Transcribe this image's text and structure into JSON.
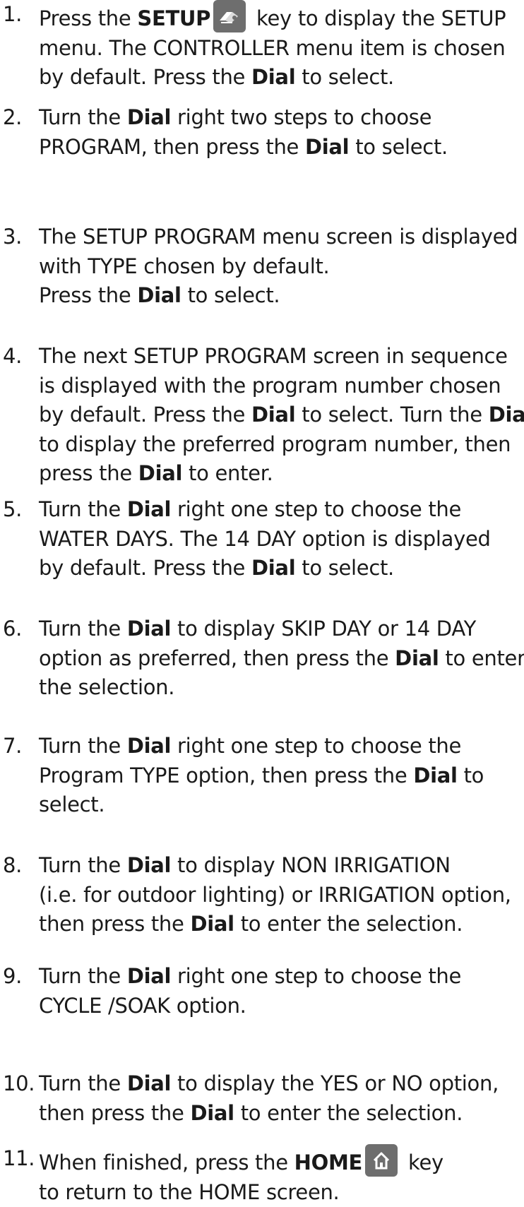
{
  "steps": [
    {
      "number": "1.",
      "lines": [
        [
          {
            "t": "Press the "
          },
          {
            "t": "SETUP",
            "b": true
          },
          {
            "icon": "setup-key-icon"
          },
          {
            "t": " key to display the SETUP"
          }
        ],
        [
          {
            "t": "menu. The CONTROLLER menu item is chosen"
          }
        ],
        [
          {
            "t": "by default. Press the "
          },
          {
            "t": "Dial",
            "b": true
          },
          {
            "t": " to select."
          }
        ]
      ]
    },
    {
      "number": "2.",
      "lines": [
        [
          {
            "t": "Turn the "
          },
          {
            "t": "Dial",
            "b": true
          },
          {
            "t": " right two steps to choose"
          }
        ],
        [
          {
            "t": "PROGRAM, then press the "
          },
          {
            "t": "Dial",
            "b": true
          },
          {
            "t": " to select."
          }
        ]
      ]
    },
    {
      "number": "3.",
      "lines": [
        [
          {
            "t": "The SETUP PROGRAM menu screen is displayed"
          }
        ],
        [
          {
            "t": "with TYPE chosen by default."
          }
        ],
        [
          {
            "t": "Press the "
          },
          {
            "t": "Dial",
            "b": true
          },
          {
            "t": " to select."
          }
        ]
      ]
    },
    {
      "number": "4.",
      "lines": [
        [
          {
            "t": "The next SETUP PROGRAM screen in sequence"
          }
        ],
        [
          {
            "t": "is displayed with the program number chosen"
          }
        ],
        [
          {
            "t": "by default. Press the "
          },
          {
            "t": "Dial",
            "b": true
          },
          {
            "t": " to select. Turn the "
          },
          {
            "t": "Dial",
            "b": true
          }
        ],
        [
          {
            "t": "to display the preferred program number, then"
          }
        ],
        [
          {
            "t": "press the "
          },
          {
            "t": "Dial",
            "b": true
          },
          {
            "t": " to enter."
          }
        ]
      ]
    },
    {
      "number": "5.",
      "lines": [
        [
          {
            "t": "Turn the "
          },
          {
            "t": "Dial",
            "b": true
          },
          {
            "t": " right one step to choose the"
          }
        ],
        [
          {
            "t": "WATER DAYS. The 14 DAY option is displayed"
          }
        ],
        [
          {
            "t": "by default. Press the "
          },
          {
            "t": "Dial",
            "b": true
          },
          {
            "t": " to select."
          }
        ]
      ]
    },
    {
      "number": "6.",
      "lines": [
        [
          {
            "t": "Turn the "
          },
          {
            "t": "Dial",
            "b": true
          },
          {
            "t": " to display SKIP DAY or 14 DAY"
          }
        ],
        [
          {
            "t": "option as preferred, then press the "
          },
          {
            "t": "Dial",
            "b": true
          },
          {
            "t": " to enter"
          }
        ],
        [
          {
            "t": "the selection."
          }
        ]
      ]
    },
    {
      "number": "7.",
      "lines": [
        [
          {
            "t": "Turn the "
          },
          {
            "t": "Dial",
            "b": true
          },
          {
            "t": " right one step to choose the"
          }
        ],
        [
          {
            "t": "Program TYPE option, then press the "
          },
          {
            "t": "Dial",
            "b": true
          },
          {
            "t": " to"
          }
        ],
        [
          {
            "t": "select."
          }
        ]
      ]
    },
    {
      "number": "8.",
      "lines": [
        [
          {
            "t": "Turn the "
          },
          {
            "t": "Dial",
            "b": true
          },
          {
            "t": " to display NON IRRIGATION"
          }
        ],
        [
          {
            "t": "(i.e. for outdoor lighting) or IRRIGATION option,"
          }
        ],
        [
          {
            "t": "then press the "
          },
          {
            "t": "Dial",
            "b": true
          },
          {
            "t": " to enter the selection."
          }
        ]
      ]
    },
    {
      "number": "9.",
      "lines": [
        [
          {
            "t": "Turn the "
          },
          {
            "t": "Dial",
            "b": true
          },
          {
            "t": " right one step to choose the"
          }
        ],
        [
          {
            "t": "CYCLE /SOAK option."
          }
        ]
      ]
    },
    {
      "number": "10.",
      "lines": [
        [
          {
            "t": "Turn the "
          },
          {
            "t": "Dial",
            "b": true
          },
          {
            "t": " to display the YES or NO option,"
          }
        ],
        [
          {
            "t": "then press the "
          },
          {
            "t": "Dial",
            "b": true
          },
          {
            "t": " to enter the selection."
          }
        ]
      ]
    },
    {
      "number": "11.",
      "lines": [
        [
          {
            "t": "When finished, press the "
          },
          {
            "t": "HOME",
            "b": true
          },
          {
            "icon": "home-key-icon"
          },
          {
            "t": " key"
          }
        ],
        [
          {
            "t": "to return to the HOME screen."
          }
        ]
      ]
    }
  ]
}
